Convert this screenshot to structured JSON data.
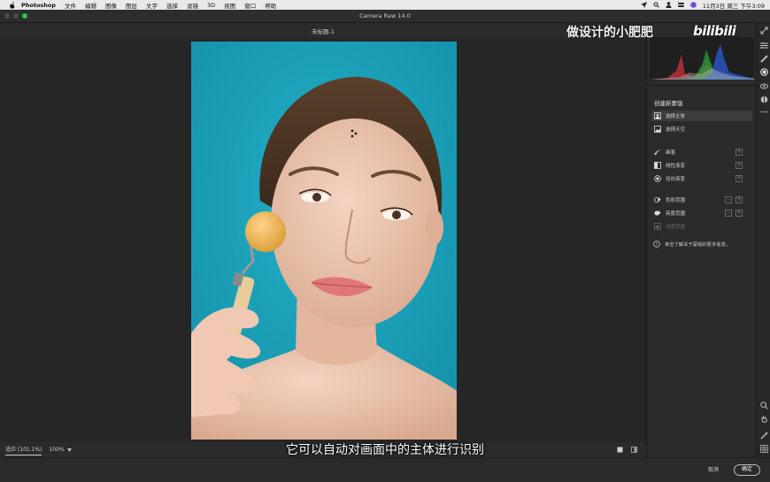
{
  "menubar": {
    "app_name": "Photoshop",
    "items": [
      "文件",
      "编辑",
      "图像",
      "图层",
      "文字",
      "选择",
      "滤镜",
      "3D",
      "视图",
      "窗口",
      "帮助"
    ],
    "datetime": "11月3日 周三 下午3:09"
  },
  "window": {
    "title": "Camera Raw 14.0"
  },
  "document": {
    "name": "未标题-1"
  },
  "canvas_footer": {
    "fit_label": "适应 (101.1%)",
    "zoom_value": "100%"
  },
  "panel": {
    "title": "创建新蒙版",
    "items": [
      {
        "label": "选择主体",
        "icon": "person-icon"
      },
      {
        "label": "选择天空",
        "icon": "sky-icon"
      },
      {
        "label": "画笔",
        "icon": "brush-icon"
      },
      {
        "label": "线性渐变",
        "icon": "linear-gradient-icon"
      },
      {
        "label": "径向渐变",
        "icon": "radial-gradient-icon"
      },
      {
        "label": "色彩范围",
        "icon": "color-range-icon"
      },
      {
        "label": "亮度范围",
        "icon": "luminance-range-icon"
      },
      {
        "label": "深度范围",
        "icon": "depth-range-icon"
      }
    ],
    "hint": "单击了解关于蒙版的更多信息。"
  },
  "buttons": {
    "cancel": "取消",
    "ok": "确定"
  },
  "overlay": {
    "watermark": "做设计的小肥肥",
    "bili_logo": "bilibili",
    "subtitle": "它可以自动对画面中的主体进行识别"
  },
  "colors": {
    "accent_green": "#2ac840",
    "photo_bg": "#1a9fb8",
    "panel_bg": "#2b2b2b",
    "canvas_bg": "#262626"
  }
}
